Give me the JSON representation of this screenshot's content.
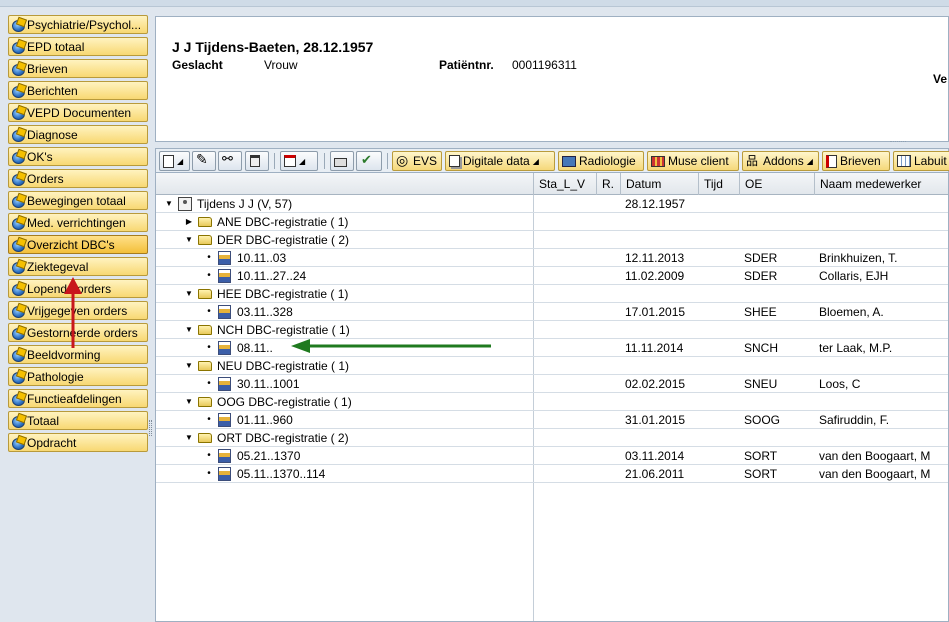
{
  "nav": {
    "items": [
      {
        "label": "Psychiatrie/Psychol..."
      },
      {
        "label": "EPD totaal"
      },
      {
        "label": "Brieven"
      },
      {
        "label": "Berichten"
      },
      {
        "label": "VEPD Documenten"
      },
      {
        "label": "Diagnose"
      },
      {
        "label": "OK's"
      },
      {
        "label": "Orders"
      },
      {
        "label": "Bewegingen totaal"
      },
      {
        "label": "Med. verrichtingen"
      },
      {
        "label": "Overzicht DBC's"
      },
      {
        "label": "Ziektegeval"
      },
      {
        "label": "Lopende orders"
      },
      {
        "label": "Vrijgegeven orders"
      },
      {
        "label": "Gestorneerde orders"
      },
      {
        "label": "Beeldvorming"
      },
      {
        "label": "Pathologie"
      },
      {
        "label": "Functieafdelingen"
      },
      {
        "label": "Totaal"
      },
      {
        "label": "Opdracht"
      }
    ],
    "active_index": 10
  },
  "header": {
    "patient_name": "J J Tijdens-Baeten, 28.12.1957",
    "gender_label": "Geslacht",
    "gender_value": "Vrouw",
    "patient_no_label": "Patiëntnr.",
    "patient_no_value": "0001196311",
    "right_text": "Ve"
  },
  "toolbar": {
    "evs": "EVS",
    "digitale_data": "Digitale data",
    "radiologie": "Radiologie",
    "muse_client": "Muse client",
    "addons": "Addons",
    "brieven": "Brieven",
    "labuit": "Labuit"
  },
  "grid": {
    "columns": [
      "Sta_L_V",
      "R.",
      "Datum",
      "Tijd",
      "OE",
      "Naam medewerker"
    ],
    "rows": [
      {
        "level": 0,
        "type": "patient",
        "toggle": "open",
        "label": "Tijdens J J (V, 57)",
        "datum": "28.12.1957",
        "oe": "",
        "naam": ""
      },
      {
        "level": 1,
        "type": "folder",
        "toggle": "closed",
        "label": "ANE DBC-registratie ( 1)",
        "datum": "",
        "oe": "",
        "naam": ""
      },
      {
        "level": 1,
        "type": "folder-open",
        "toggle": "open",
        "label": "DER DBC-registratie ( 2)",
        "datum": "",
        "oe": "",
        "naam": ""
      },
      {
        "level": 2,
        "type": "dbc",
        "toggle": "leaf",
        "label": "10.11..03",
        "datum": "12.11.2013",
        "oe": "SDER",
        "naam": "Brinkhuizen, T."
      },
      {
        "level": 2,
        "type": "dbc",
        "toggle": "leaf",
        "label": "10.11..27..24",
        "datum": "11.02.2009",
        "oe": "SDER",
        "naam": "Collaris, EJH"
      },
      {
        "level": 1,
        "type": "folder-open",
        "toggle": "open",
        "label": "HEE DBC-registratie ( 1)",
        "datum": "",
        "oe": "",
        "naam": ""
      },
      {
        "level": 2,
        "type": "dbc",
        "toggle": "leaf",
        "label": "03.11..328",
        "datum": "17.01.2015",
        "oe": "SHEE",
        "naam": "Bloemen, A."
      },
      {
        "level": 1,
        "type": "folder-open",
        "toggle": "open",
        "label": "NCH DBC-registratie ( 1)",
        "datum": "",
        "oe": "",
        "naam": ""
      },
      {
        "level": 2,
        "type": "dbc",
        "toggle": "leaf",
        "label": "08.11..",
        "datum": "11.11.2014",
        "oe": "SNCH",
        "naam": "ter Laak, M.P."
      },
      {
        "level": 1,
        "type": "folder-open",
        "toggle": "open",
        "label": "NEU DBC-registratie ( 1)",
        "datum": "",
        "oe": "",
        "naam": ""
      },
      {
        "level": 2,
        "type": "dbc",
        "toggle": "leaf",
        "label": "30.11..1001",
        "datum": "02.02.2015",
        "oe": "SNEU",
        "naam": "Loos, C"
      },
      {
        "level": 1,
        "type": "folder-open",
        "toggle": "open",
        "label": "OOG DBC-registratie ( 1)",
        "datum": "",
        "oe": "",
        "naam": ""
      },
      {
        "level": 2,
        "type": "dbc",
        "toggle": "leaf",
        "label": "01.11..960",
        "datum": "31.01.2015",
        "oe": "SOOG",
        "naam": "Safiruddin, F."
      },
      {
        "level": 1,
        "type": "folder-open",
        "toggle": "open",
        "label": "ORT DBC-registratie ( 2)",
        "datum": "",
        "oe": "",
        "naam": ""
      },
      {
        "level": 2,
        "type": "dbc",
        "toggle": "leaf",
        "label": "05.21..1370",
        "datum": "03.11.2014",
        "oe": "SORT",
        "naam": "van den Boogaart, M"
      },
      {
        "level": 2,
        "type": "dbc",
        "toggle": "leaf",
        "label": "05.11..1370..114",
        "datum": "21.06.2011",
        "oe": "SORT",
        "naam": "van den Boogaart, M"
      }
    ]
  },
  "annotations": {
    "red_arrow_color": "#c8161d",
    "green_arrow_color": "#1f7a1f"
  }
}
